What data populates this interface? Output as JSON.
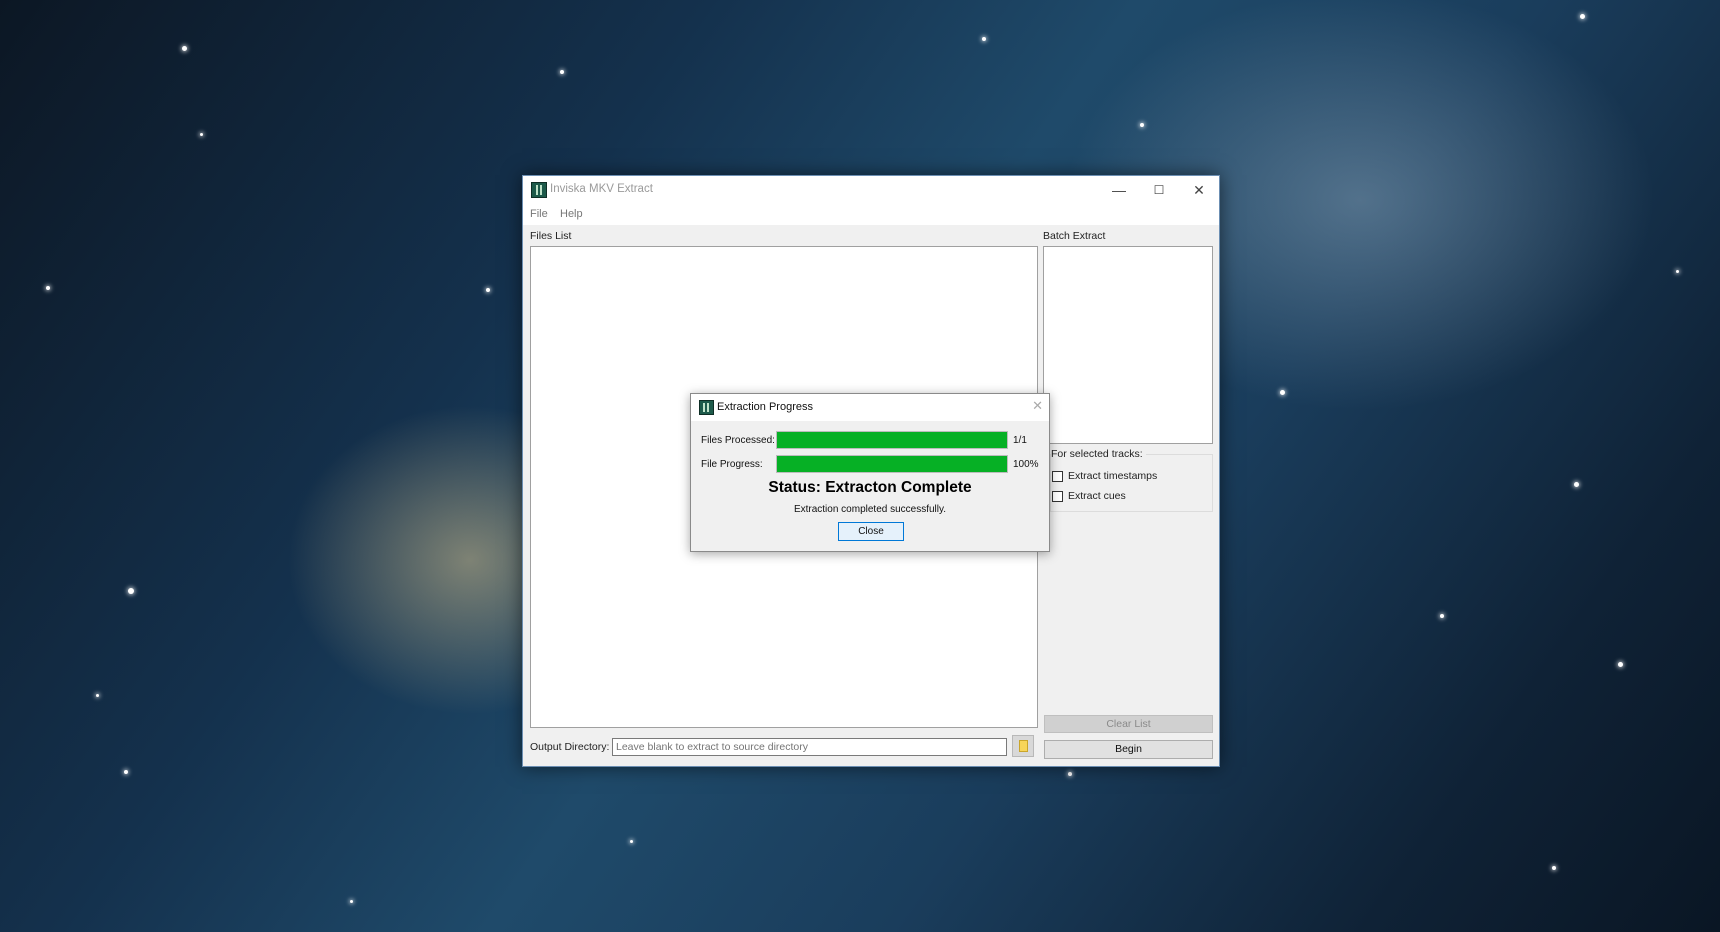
{
  "window": {
    "title": "Inviska MKV Extract",
    "controls": {
      "minimize": "—",
      "maximize": "☐",
      "close": "✕"
    },
    "menu": [
      "File",
      "Help"
    ]
  },
  "files_list": {
    "label": "Files List"
  },
  "batch_extract": {
    "label": "Batch Extract",
    "group_title": "For selected tracks:",
    "options": [
      {
        "label": "Extract timestamps",
        "checked": false
      },
      {
        "label": "Extract cues",
        "checked": false
      }
    ],
    "clear_label": "Clear List",
    "begin_label": "Begin"
  },
  "output": {
    "label": "Output Directory:",
    "placeholder": "Leave blank to extract to source directory",
    "value": ""
  },
  "dialog": {
    "title": "Extraction Progress",
    "close_glyph": "✕",
    "files_processed_label": "Files Processed:",
    "files_processed_text": "1/1",
    "files_processed_fraction": 1.0,
    "file_progress_label": "File Progress:",
    "file_progress_text": "100%",
    "file_progress_fraction": 1.0,
    "status": "Status: Extracton Complete",
    "message": "Extraction completed successfully.",
    "close_label": "Close"
  },
  "colors": {
    "progress_fill": "#06b025",
    "dialog_button_border": "#0078d7"
  }
}
